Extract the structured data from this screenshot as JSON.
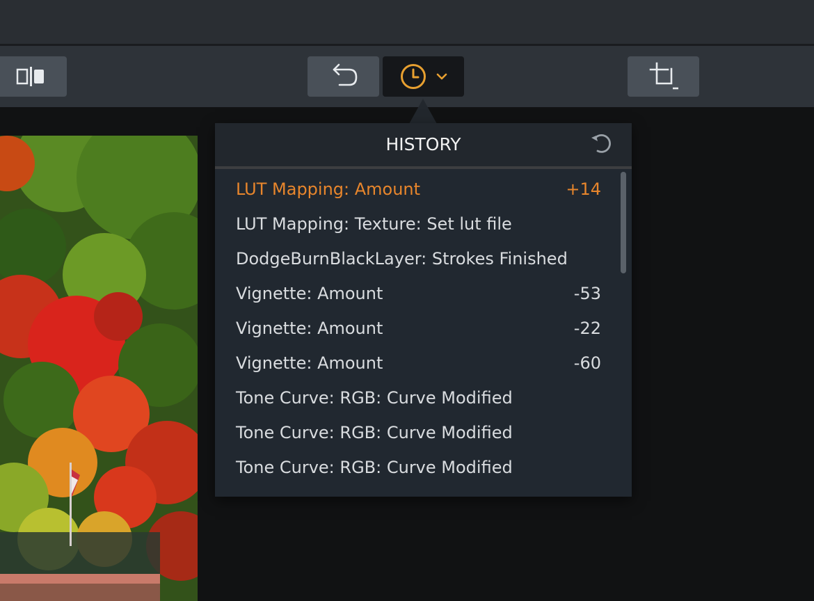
{
  "toolbar": {
    "compare_icon": "compare-split-icon",
    "undo_icon": "undo-arrow-icon",
    "history_icon": "clock-icon",
    "history_dropdown_icon": "chevron-down-icon",
    "crop_icon": "crop-icon"
  },
  "history": {
    "title": "HISTORY",
    "reset_icon": "reset-icon",
    "items": [
      {
        "label": "LUT Mapping: Amount",
        "value": "+14",
        "active": true
      },
      {
        "label": "LUT Mapping: Texture: Set lut file",
        "value": ""
      },
      {
        "label": "DodgeBurnBlackLayer: Strokes Finished",
        "value": ""
      },
      {
        "label": "Vignette: Amount",
        "value": "-53"
      },
      {
        "label": "Vignette: Amount",
        "value": "-22"
      },
      {
        "label": "Vignette: Amount",
        "value": "-60"
      },
      {
        "label": "Tone Curve: RGB: Curve Modified",
        "value": ""
      },
      {
        "label": "Tone Curve: RGB: Curve Modified",
        "value": ""
      },
      {
        "label": "Tone Curve: RGB: Curve Modified",
        "value": ""
      }
    ]
  },
  "colors": {
    "accent": "#e8862c",
    "panel": "#212830",
    "text": "#d9dcdf",
    "icon_active": "#e8a030"
  }
}
